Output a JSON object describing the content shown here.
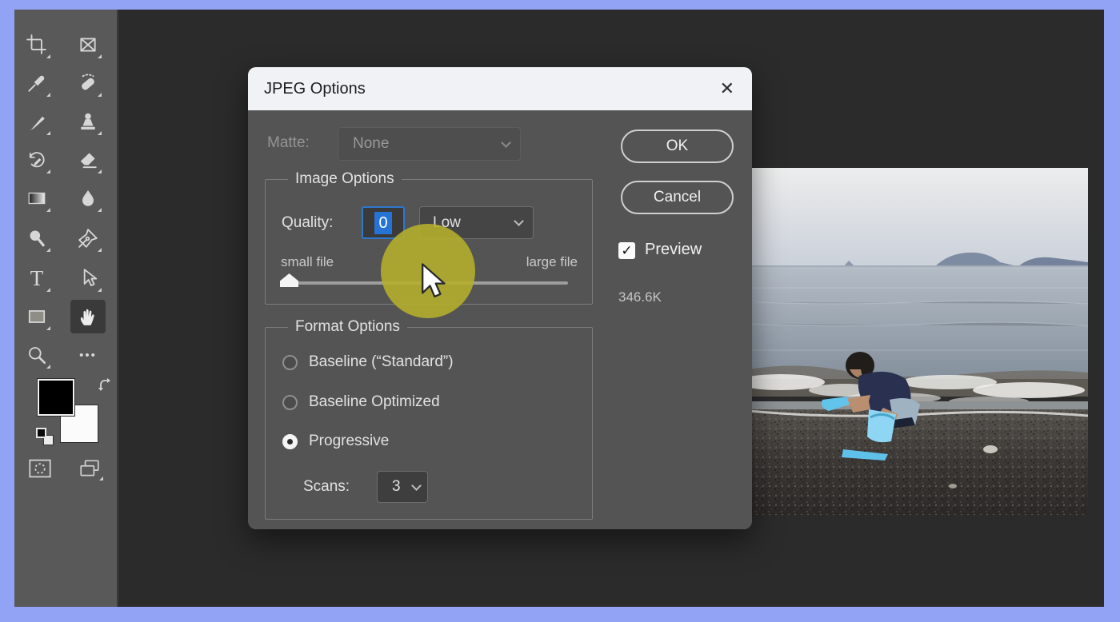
{
  "window": {
    "border_color": "#92a2f4",
    "canvas_color": "#2b2b2b",
    "toolbar_color": "#595959"
  },
  "toolbar": {
    "active_tool": "hand",
    "tools": [
      "crop",
      "frame",
      "eyedropper",
      "spot-healing",
      "brush",
      "clone-stamp",
      "history-brush",
      "eraser",
      "gradient",
      "blur",
      "dodge",
      "pen",
      "type",
      "path-select",
      "rectangle",
      "hand",
      "zoom",
      "more",
      "quick-mask",
      "screen-mode"
    ],
    "type_tool_glyph": "T",
    "more_tool_glyph": "•••"
  },
  "dialog": {
    "title": "JPEG Options",
    "close_icon": "✕",
    "matte": {
      "label": "Matte:",
      "value": "None"
    },
    "image_options": {
      "legend": "Image Options",
      "quality_label": "Quality:",
      "quality_value": "0",
      "quality_preset": "Low",
      "slider": {
        "left_label": "small file",
        "right_label": "large file",
        "value_percent": 0
      }
    },
    "format_options": {
      "legend": "Format Options",
      "radios": [
        {
          "label": "Baseline (“Standard”)",
          "selected": false
        },
        {
          "label": "Baseline Optimized",
          "selected": false
        },
        {
          "label": "Progressive",
          "selected": true
        }
      ],
      "scans_label": "Scans:",
      "scans_value": "3"
    },
    "buttons": {
      "ok": "OK",
      "cancel": "Cancel"
    },
    "preview": {
      "label": "Preview",
      "checked": true,
      "check_icon": "✓"
    },
    "file_size": "346.6K"
  },
  "preview_image": {
    "description": "Boy crouching on a pebble beach at the water's edge with blue sand toys, hazy sea and distant hills"
  },
  "cursor": {
    "style": "arrow",
    "highlight_color": "#b5b12b"
  }
}
